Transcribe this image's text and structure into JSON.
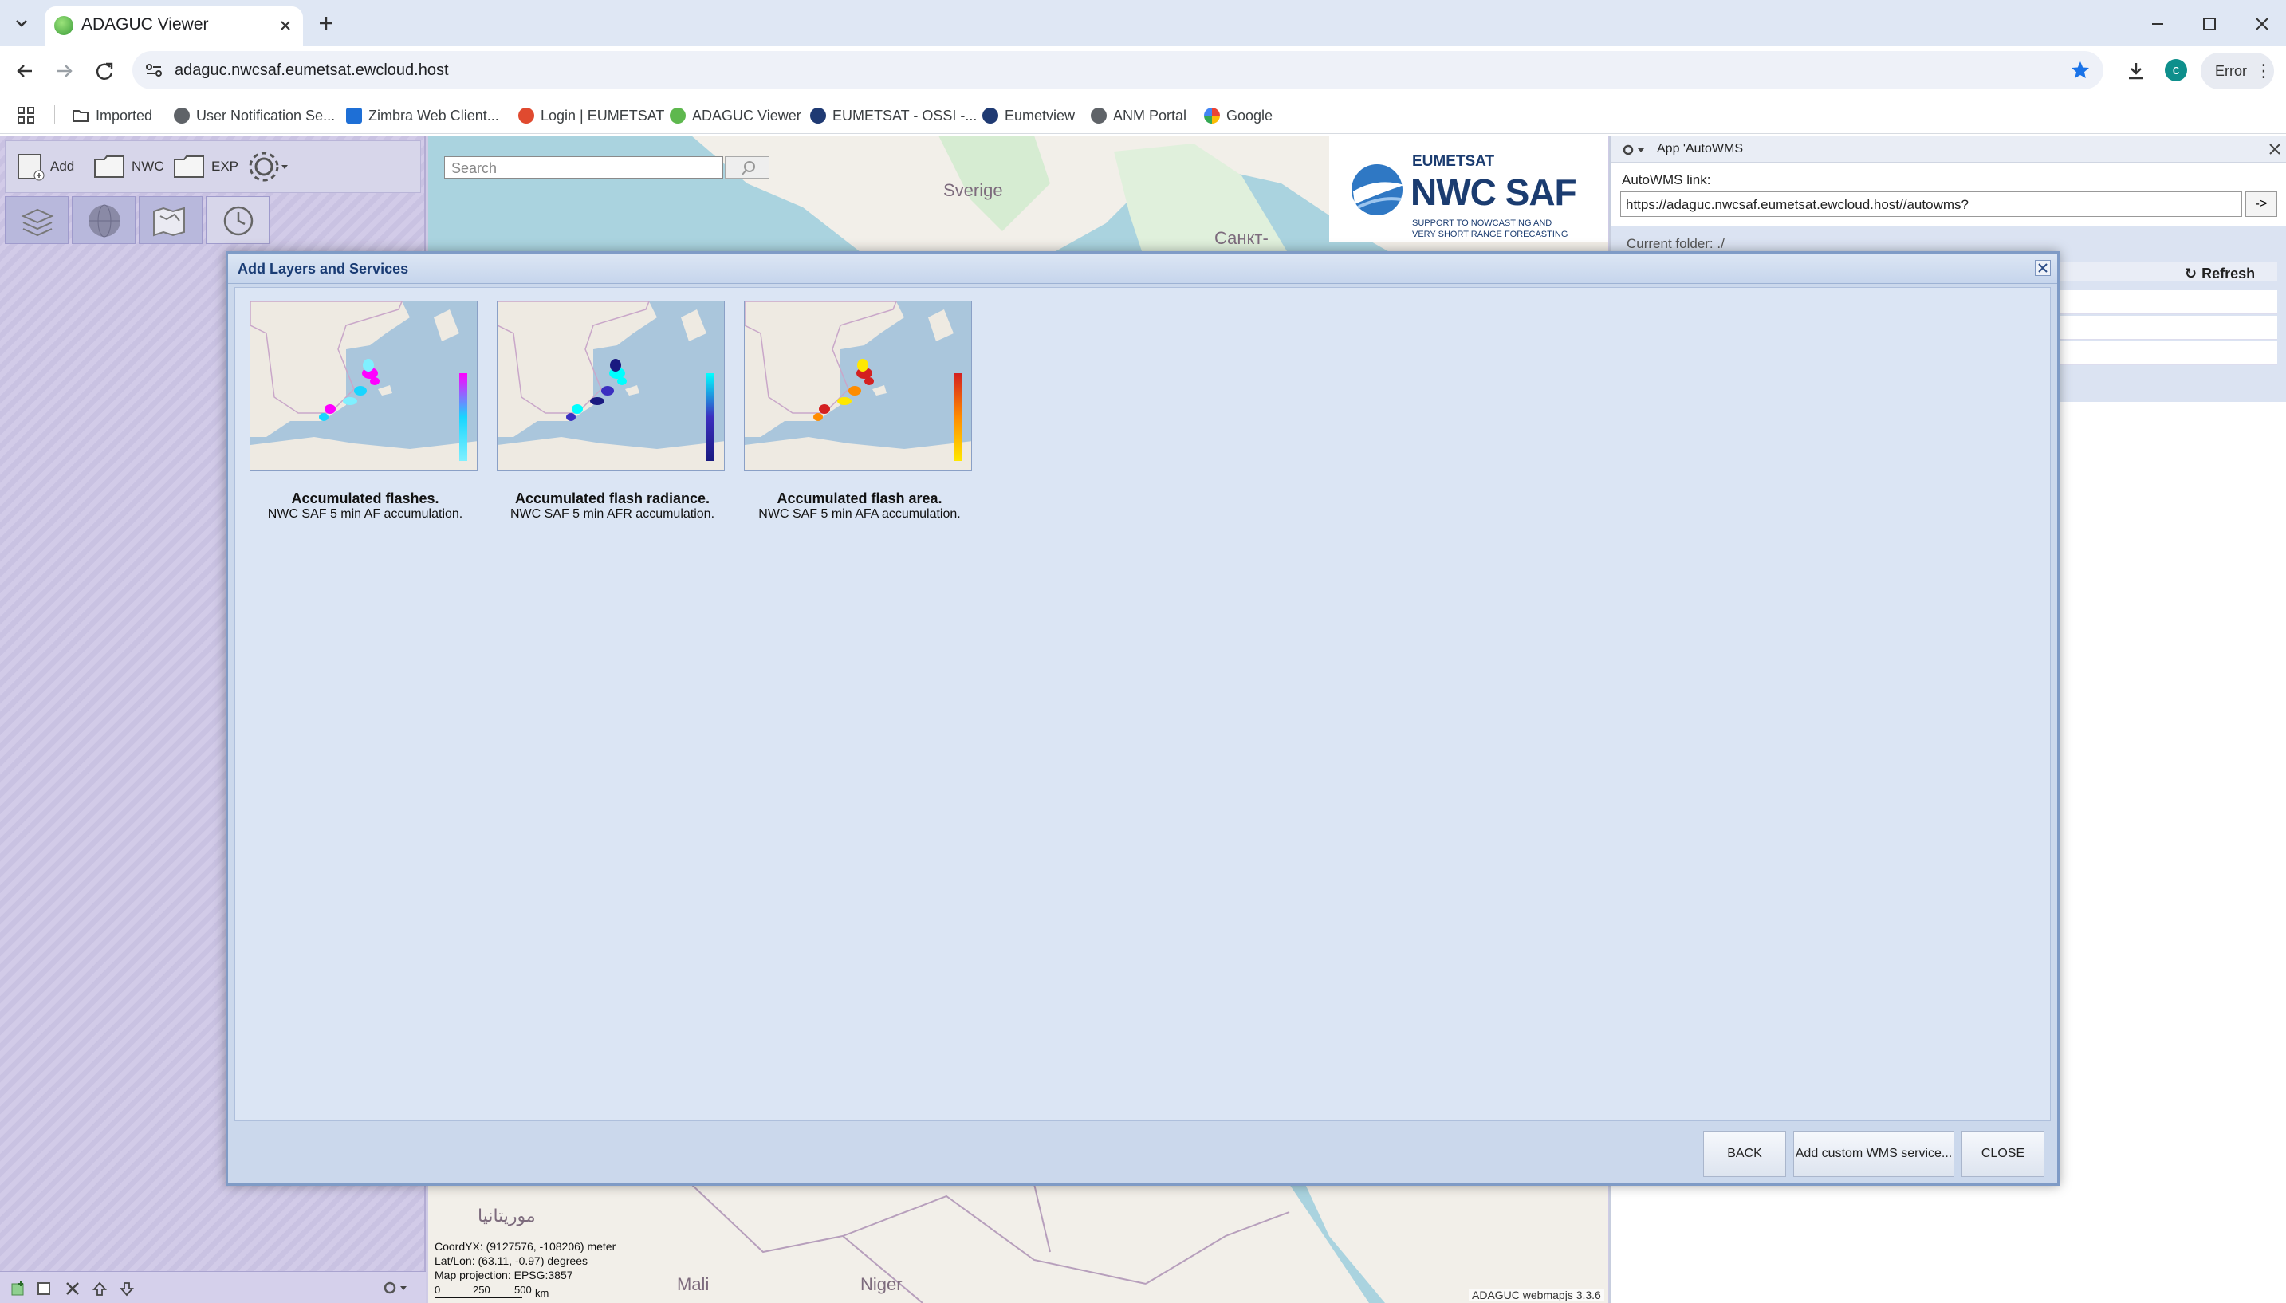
{
  "browser": {
    "tab_title": "ADAGUC Viewer",
    "url": "adaguc.nwcsaf.eumetsat.ewcloud.host",
    "profile_initial": "c",
    "error_label": "Error",
    "bookmarks": [
      {
        "label": "Imported",
        "icon": "folder-icon"
      },
      {
        "label": "User Notification Se...",
        "icon": "globe-icon"
      },
      {
        "label": "Zimbra Web Client...",
        "icon": "zimbra-icon"
      },
      {
        "label": "Login | EUMETSAT",
        "icon": "eumetsat-login-icon"
      },
      {
        "label": "ADAGUC Viewer",
        "icon": "adaguc-icon"
      },
      {
        "label": "EUMETSAT - OSSI -...",
        "icon": "eumetsat-icon"
      },
      {
        "label": "Eumetview",
        "icon": "eumetview-icon"
      },
      {
        "label": "ANM Portal",
        "icon": "globe-icon"
      },
      {
        "label": "Google",
        "icon": "google-icon"
      }
    ]
  },
  "toolbar": {
    "add_label": "Add",
    "nwc_label": "NWC",
    "exp_label": "EXP"
  },
  "map": {
    "search_placeholder": "Search",
    "labels": {
      "sverige": "Sverige",
      "sankt": "Санкт-",
      "mauritania": "موريتانيا",
      "mali": "Mali",
      "niger": "Niger"
    },
    "readout": {
      "coord": "CoordYX: (9127576, -108206) meter",
      "latlon": "Lat/Lon: (63.11, -0.97) degrees",
      "projection": "Map projection: EPSG:3857",
      "scale_ticks": [
        "0",
        "250",
        "500"
      ],
      "scale_unit": "km"
    },
    "version": "ADAGUC webmapjs 3.3.6"
  },
  "logo": {
    "org": "EUMETSAT",
    "name": "NWC SAF",
    "tagline1": "SUPPORT TO NOWCASTING AND",
    "tagline2": "VERY SHORT RANGE FORECASTING"
  },
  "right_panel": {
    "title": "App 'AutoWMS",
    "link_label": "AutoWMS link:",
    "link_value": "https://adaguc.nwcsaf.eumetsat.ewcloud.host//autowms?",
    "go_label": "->",
    "current_folder": "Current folder: ./",
    "refresh_label": "Refresh"
  },
  "dialog": {
    "title": "Add Layers and Services",
    "layers": [
      {
        "title": "Accumulated flashes.",
        "subtitle": "NWC SAF 5 min AF accumulation.",
        "palette": [
          "#ff00ff",
          "#19d5ff",
          "#7ff0ff"
        ]
      },
      {
        "title": "Accumulated flash radiance.",
        "subtitle": "NWC SAF 5 min AFR accumulation.",
        "palette": [
          "#00ffff",
          "#3b2fc0",
          "#1a1a80"
        ]
      },
      {
        "title": "Accumulated flash area.",
        "subtitle": "NWC SAF 5 min AFA accumulation.",
        "palette": [
          "#d42020",
          "#ff8c00",
          "#ffe800"
        ]
      }
    ],
    "back_label": "BACK",
    "custom_label": "Add custom WMS service...",
    "close_label": "CLOSE"
  }
}
